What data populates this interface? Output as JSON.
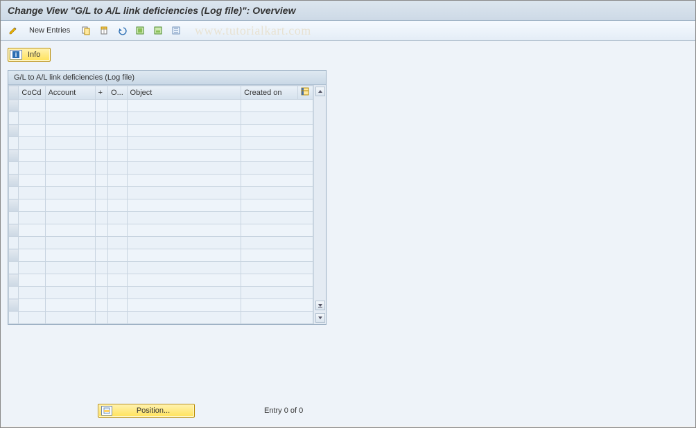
{
  "header": {
    "title": "Change View \"G/L to A/L link deficiencies (Log file)\": Overview"
  },
  "toolbar": {
    "new_entries": "New Entries",
    "icons": {
      "pencil": "toggle-display-change",
      "copy": "copy-as",
      "delete": "delete",
      "undo": "undo",
      "select_all": "select-all",
      "select_block": "select-block",
      "deselect": "deselect-all"
    }
  },
  "watermark": "www.tutorialkart.com",
  "info_button": "Info",
  "panel": {
    "title": "G/L to A/L link deficiencies (Log file)",
    "columns": {
      "cocd": "CoCd",
      "account": "Account",
      "plus": "+",
      "o": "O...",
      "object": "Object",
      "created": "Created on"
    },
    "row_count": 18
  },
  "footer": {
    "position_label": "Position...",
    "entry_text": "Entry 0 of 0"
  }
}
